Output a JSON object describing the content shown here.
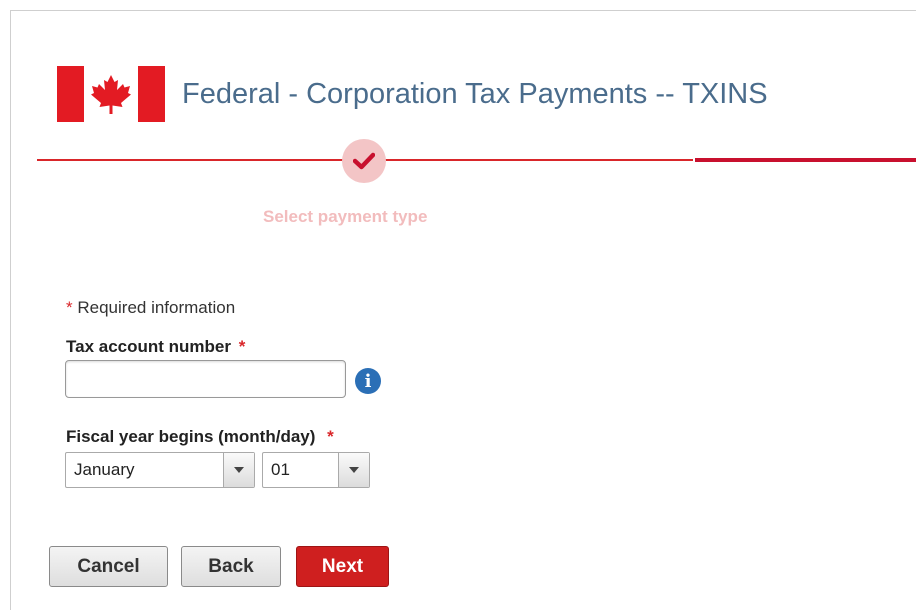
{
  "header": {
    "title": "Federal - Corporation Tax Payments -- TXINS",
    "flag_icon": "canada-flag-icon"
  },
  "progress": {
    "steps": [
      {
        "label": "Select payment type",
        "status": "complete",
        "icon": "checkmark-icon"
      }
    ],
    "colors": {
      "complete": "#f3c5c6",
      "line": "#d9262a"
    }
  },
  "form": {
    "required_star": "*",
    "required_note": "Required information",
    "tax_account": {
      "label": "Tax account number",
      "value": "",
      "placeholder": "",
      "info_icon": "info-icon"
    },
    "fiscal_year": {
      "label": "Fiscal year begins (month/day)",
      "month": "January",
      "day": "01"
    }
  },
  "buttons": {
    "cancel": "Cancel",
    "back": "Back",
    "next": "Next"
  },
  "colors": {
    "title": "#4a6c8c",
    "accent": "#cf1f1f",
    "info": "#2b6fb6"
  }
}
